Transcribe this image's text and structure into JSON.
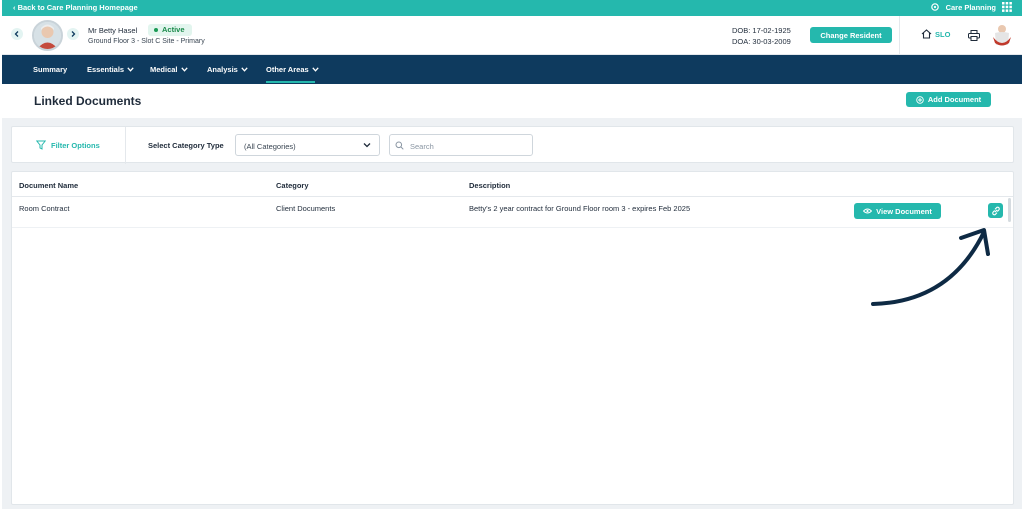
{
  "topbar": {
    "back_label": "Back to Care Planning Homepage",
    "app_label": "Care Planning"
  },
  "resident": {
    "name": "Mr Betty Hasel",
    "status": "Active",
    "location": "Ground Floor 3 - Slot C Site - Primary",
    "dob": "DOB: 17-02-1925",
    "doa": "DOA: 30-03-2009",
    "change_label": "Change Resident"
  },
  "header": {
    "home_label": "SLO"
  },
  "nav": {
    "items": [
      {
        "label": "Summary"
      },
      {
        "label": "Essentials"
      },
      {
        "label": "Medical"
      },
      {
        "label": "Analysis"
      },
      {
        "label": "Other Areas"
      }
    ]
  },
  "page": {
    "title": "Linked Documents",
    "add_label": "Add Document"
  },
  "filters": {
    "toggle_label": "Filter Options",
    "category_label": "Select Category Type",
    "category_value": "(All Categories)",
    "search_placeholder": "Search"
  },
  "table": {
    "headers": [
      "Document Name",
      "Category",
      "Description"
    ],
    "rows": [
      {
        "name": "Room Contract",
        "category": "Client Documents",
        "description": "Betty's 2 year contract for Ground Floor room 3 - expires Feb 2025",
        "view_label": "View Document"
      }
    ]
  },
  "colors": {
    "accent": "#25b8ad",
    "nav_bg": "#0e3a5e",
    "page_bg": "#eef1f4",
    "annotation": "#0e2a44"
  },
  "icons": {
    "gear": "gear-icon",
    "grid": "grid-icon",
    "home": "home-icon",
    "printer": "printer-icon",
    "filter": "filter-icon",
    "search": "search-icon",
    "eye": "eye-icon",
    "link": "link-icon"
  }
}
